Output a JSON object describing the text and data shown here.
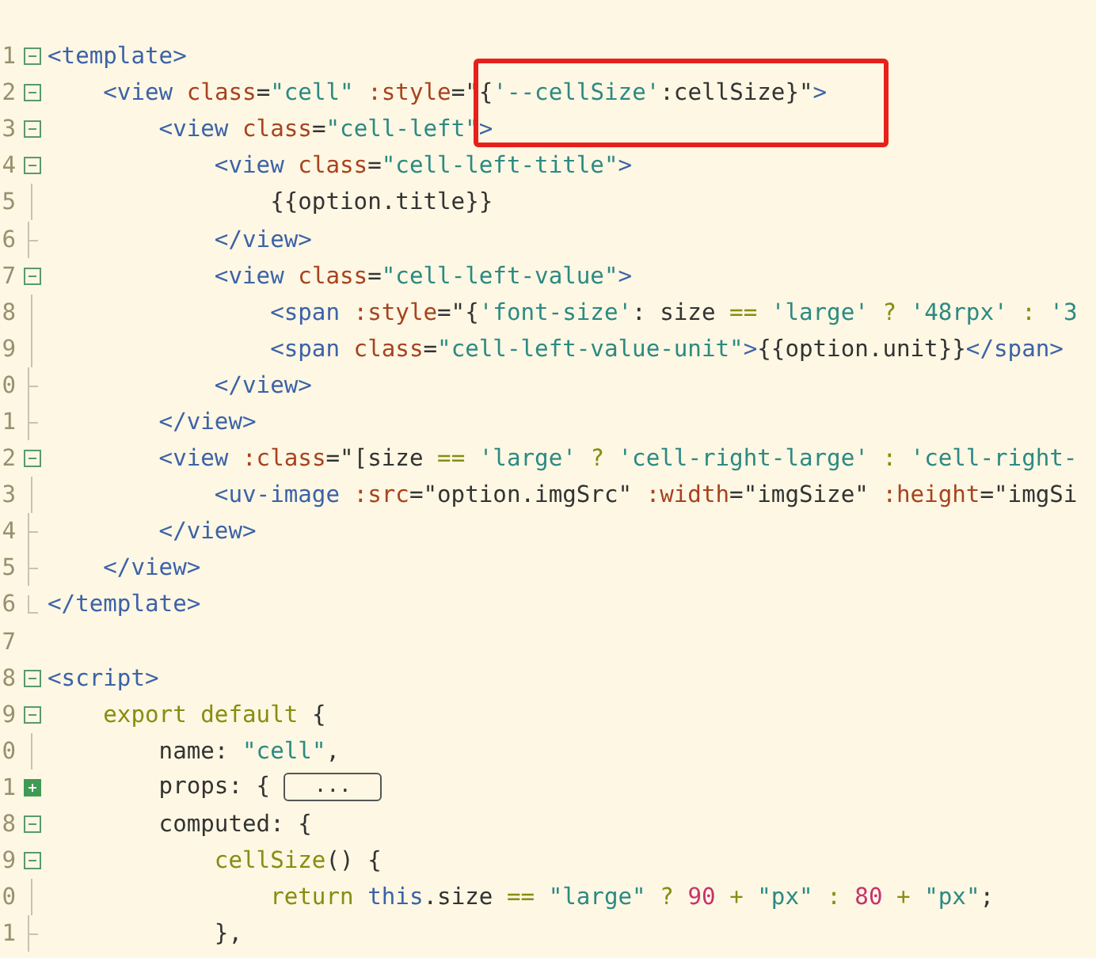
{
  "callout": {
    "kind": "box"
  },
  "lines": [
    {
      "number": "1",
      "kind": "open",
      "tokens": [
        {
          "t": "<template>",
          "kind": "tag"
        }
      ]
    },
    {
      "number": "2",
      "kind": "open",
      "tokens": [
        {
          "t": "    <view ",
          "kind": "tag"
        },
        {
          "t": "class",
          "kind": "attr"
        },
        {
          "t": "=",
          "kind": "text"
        },
        {
          "t": "\"cell\"",
          "kind": "str"
        },
        {
          "t": " :style",
          "kind": "attr"
        },
        {
          "t": "=\"{",
          "kind": "text"
        },
        {
          "t": "'--cellSize'",
          "kind": "str"
        },
        {
          "t": ":cellSize}\"",
          "kind": "text"
        },
        {
          "t": ">",
          "kind": "tag"
        }
      ]
    },
    {
      "number": "3",
      "kind": "open",
      "tokens": [
        {
          "t": "        <view ",
          "kind": "tag"
        },
        {
          "t": "class",
          "kind": "attr"
        },
        {
          "t": "=",
          "kind": "text"
        },
        {
          "t": "\"cell-left\"",
          "kind": "str"
        },
        {
          "t": ">",
          "kind": "tag"
        }
      ]
    },
    {
      "number": "4",
      "kind": "open",
      "tokens": [
        {
          "t": "            <view ",
          "kind": "tag"
        },
        {
          "t": "class",
          "kind": "attr"
        },
        {
          "t": "=",
          "kind": "text"
        },
        {
          "t": "\"cell-left-title\"",
          "kind": "str"
        },
        {
          "t": ">",
          "kind": "tag"
        }
      ]
    },
    {
      "number": "5",
      "kind": "line",
      "tokens": [
        {
          "t": "                {{option.title}}",
          "kind": "text"
        }
      ]
    },
    {
      "number": "6",
      "kind": "end",
      "tokens": [
        {
          "t": "            </view>",
          "kind": "tag"
        }
      ]
    },
    {
      "number": "7",
      "kind": "open",
      "tokens": [
        {
          "t": "            <view ",
          "kind": "tag"
        },
        {
          "t": "class",
          "kind": "attr"
        },
        {
          "t": "=",
          "kind": "text"
        },
        {
          "t": "\"cell-left-value\"",
          "kind": "str"
        },
        {
          "t": ">",
          "kind": "tag"
        }
      ]
    },
    {
      "number": "8",
      "kind": "line",
      "tokens": [
        {
          "t": "                <span ",
          "kind": "tag"
        },
        {
          "t": ":style",
          "kind": "attr"
        },
        {
          "t": "=\"{",
          "kind": "text"
        },
        {
          "t": "'font-size'",
          "kind": "str"
        },
        {
          "t": ": size ",
          "kind": "text"
        },
        {
          "t": "== ",
          "kind": "kw"
        },
        {
          "t": "'large'",
          "kind": "str"
        },
        {
          "t": " ? ",
          "kind": "kw"
        },
        {
          "t": "'48rpx'",
          "kind": "str"
        },
        {
          "t": " : ",
          "kind": "kw"
        },
        {
          "t": "'3",
          "kind": "str"
        }
      ]
    },
    {
      "number": "9",
      "kind": "line",
      "tokens": [
        {
          "t": "                <span ",
          "kind": "tag"
        },
        {
          "t": "class",
          "kind": "attr"
        },
        {
          "t": "=",
          "kind": "text"
        },
        {
          "t": "\"cell-left-value-unit\"",
          "kind": "str"
        },
        {
          "t": ">",
          "kind": "tag"
        },
        {
          "t": "{{option.unit}}",
          "kind": "text"
        },
        {
          "t": "</span>",
          "kind": "tag"
        }
      ]
    },
    {
      "number": "0",
      "kind": "end",
      "tokens": [
        {
          "t": "            </view>",
          "kind": "tag"
        }
      ]
    },
    {
      "number": "1",
      "kind": "end",
      "tokens": [
        {
          "t": "        </view>",
          "kind": "tag"
        }
      ]
    },
    {
      "number": "2",
      "kind": "open",
      "tokens": [
        {
          "t": "        <view ",
          "kind": "tag"
        },
        {
          "t": ":class",
          "kind": "attr"
        },
        {
          "t": "=\"[size ",
          "kind": "text"
        },
        {
          "t": "== ",
          "kind": "kw"
        },
        {
          "t": "'large'",
          "kind": "str"
        },
        {
          "t": " ? ",
          "kind": "kw"
        },
        {
          "t": "'cell-right-large'",
          "kind": "str"
        },
        {
          "t": " : ",
          "kind": "kw"
        },
        {
          "t": "'cell-right-",
          "kind": "str"
        }
      ]
    },
    {
      "number": "3",
      "kind": "line",
      "tokens": [
        {
          "t": "            <uv-image ",
          "kind": "tag"
        },
        {
          "t": ":src",
          "kind": "attr"
        },
        {
          "t": "=\"option.imgSrc\" ",
          "kind": "text"
        },
        {
          "t": ":width",
          "kind": "attr"
        },
        {
          "t": "=\"imgSize\" ",
          "kind": "text"
        },
        {
          "t": ":height",
          "kind": "attr"
        },
        {
          "t": "=\"imgSi",
          "kind": "text"
        }
      ]
    },
    {
      "number": "4",
      "kind": "end",
      "tokens": [
        {
          "t": "        </view>",
          "kind": "tag"
        }
      ]
    },
    {
      "number": "5",
      "kind": "end",
      "tokens": [
        {
          "t": "    </view>",
          "kind": "tag"
        }
      ]
    },
    {
      "number": "6",
      "kind": "last",
      "tokens": [
        {
          "t": "</template>",
          "kind": "tag"
        }
      ]
    },
    {
      "number": "7",
      "kind": "none"
    },
    {
      "number": "8",
      "kind": "open",
      "tokens": [
        {
          "t": "<script>",
          "kind": "tag"
        }
      ]
    },
    {
      "number": "9",
      "kind": "open",
      "tokens": [
        {
          "t": "    export default",
          "kind": "kw"
        },
        {
          "t": " {",
          "kind": "text"
        }
      ]
    },
    {
      "number": "0",
      "kind": "line",
      "tokens": [
        {
          "t": "        name: ",
          "kind": "text"
        },
        {
          "t": "\"cell\"",
          "kind": "str"
        },
        {
          "t": ",",
          "kind": "text"
        }
      ]
    },
    {
      "number": "1",
      "kind": "closed",
      "tokens": [
        {
          "t": "        props: { ",
          "kind": "text"
        },
        {
          "t": "...",
          "kind": "folded"
        }
      ]
    },
    {
      "number": "8",
      "kind": "open",
      "tokens": [
        {
          "t": "        computed: {",
          "kind": "text"
        }
      ]
    },
    {
      "number": "9",
      "kind": "open",
      "tokens": [
        {
          "t": "            cellSize",
          "kind": "kw"
        },
        {
          "t": "() {",
          "kind": "text"
        }
      ]
    },
    {
      "number": "0",
      "kind": "line",
      "tokens": [
        {
          "t": "                return ",
          "kind": "kw"
        },
        {
          "t": "this",
          "kind": "tag"
        },
        {
          "t": ".size ",
          "kind": "text"
        },
        {
          "t": "== ",
          "kind": "kw"
        },
        {
          "t": "\"large\"",
          "kind": "str"
        },
        {
          "t": " ? ",
          "kind": "kw"
        },
        {
          "t": "90",
          "kind": "num"
        },
        {
          "t": " + ",
          "kind": "kw"
        },
        {
          "t": "\"px\"",
          "kind": "str"
        },
        {
          "t": " : ",
          "kind": "kw"
        },
        {
          "t": "80",
          "kind": "num"
        },
        {
          "t": " + ",
          "kind": "kw"
        },
        {
          "t": "\"px\"",
          "kind": "str"
        },
        {
          "t": ";",
          "kind": "text"
        }
      ]
    },
    {
      "number": "1",
      "kind": "end",
      "tokens": [
        {
          "t": "            },",
          "kind": "text"
        }
      ]
    }
  ]
}
